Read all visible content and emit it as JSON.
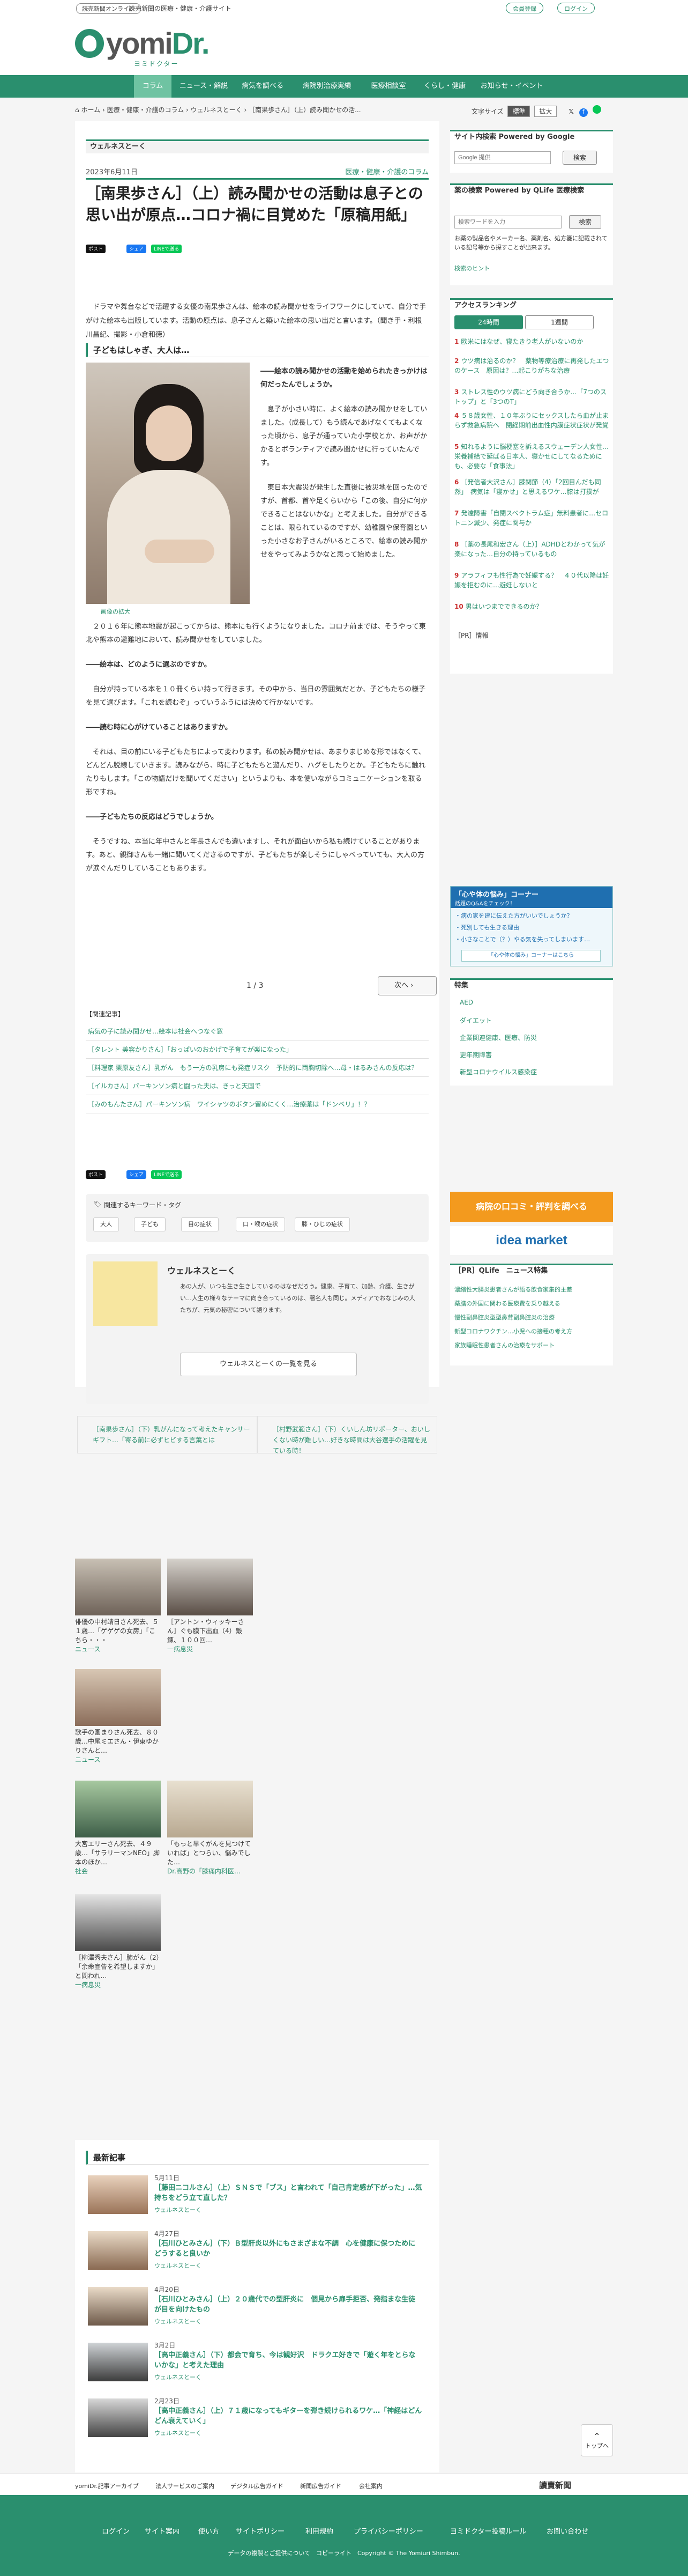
{
  "header": {
    "brand_link": "読売新聞オンライン",
    "tagline": "読売新聞の医療・健康・介護サイト",
    "register": "会員登録",
    "login": "ログイン",
    "logo_main": "yomi",
    "logo_accent": "Dr.",
    "logo_sub": "ヨミドクター"
  },
  "nav": [
    "コラム",
    "ニュース・解説",
    "病気を調べる",
    "病院別治療実績",
    "医療相談室",
    "くらし・健康",
    "お知らせ・イベント"
  ],
  "breadcrumb": [
    "ホーム",
    "医療・健康・介護のコラム",
    "ウェルネスとーく",
    "［南果歩さん］（上）読み聞かせの活..."
  ],
  "textsize": {
    "label": "文字サイズ",
    "standard": "標準",
    "large": "拡大"
  },
  "article": {
    "section": "ウェルネスとーく",
    "date": "2023年6月11日",
    "category": "医療・健康・介護のコラム",
    "title": "［南果歩さん］（上）読み聞かせの活動は息子との思い出が原点…コロナ禍に目覚めた「原稿用紙」",
    "share": {
      "post": "ポスト",
      "fb": "シェア",
      "line": "LINEで送る"
    },
    "lead": "ドラマや舞台などで活躍する女優の南果歩さんは、絵本の読み聞かせをライフワークにしていて、自分で手がけた絵本も出版しています。活動の原点は、息子さんと築いた絵本の思い出だと言います。（聞き手・利根川昌紀、撮影・小倉和徳）",
    "h2": "子どもはしゃぎ、大人は…",
    "zoom": "画像の拡大",
    "side_paras": [
      "――絵本の読み聞かせの活動を始められたきっかけは何だったんでしょうか。",
      "息子が小さい時に、よく絵本の読み聞かせをしていました。（成長して）もう読んであげなくてもよくなった頃から、息子が通っていた小学校とか、お声がかかるとボランティアで読み聞かせに行っていたんです。",
      "東日本大震災が発生した直後に被災地を回ったのですが、首都、首や足くらいから「この後、自分に何かできることはないかな」と考えました。自分ができることは、限られているのですが、幼稚園や保育園といった小さなお子さんがいるところで、絵本の読み聞かせをやってみようかなと思って始めました。"
    ],
    "body_paras": [
      "２０１６年に熊本地震が起こってからは、熊本にも行くようになりました。コロナ前までは、そうやって東北や熊本の避難地において、読み聞かせをしていました。",
      "――絵本は、どのように選ぶのですか。",
      "自分が持っている本を１０冊くらい持って行きます。その中から、当日の雰囲気だとか、子どもたちの様子を見て選びます。「これを読むぞ」っていうふうには決めて行かないです。",
      "――読む時に心がけていることはありますか。",
      "それは、目の前にいる子どもたちによって変わります。私の読み聞かせは、あまりまじめな形ではなくて、どんどん脱線していきます。読みながら、時に子どもたちと遊んだり、ハグをしたりとか。子どもたちに触れたりもします。「この物語だけを聞いてください」というよりも、本を使いながらコミュニケーションを取る形ですね。",
      "――子どもたちの反応はどうでしょうか。",
      "そうですね、本当に年中さんと年長さんでも違いますし、それが面白いから私も続けていることがあります。あと、親御さんも一緒に聞いてくださるのですが、子どもたちが楽しそうにしゃべっていても、大人の方が涙ぐんだりしていることもあります。"
    ],
    "pager": {
      "current": "1 / 3",
      "next": "次へ"
    }
  },
  "related": {
    "title": "【関連記事】",
    "items": [
      "病気の子に読み聞かせ…絵本は社会へつなぐ窓",
      "［タレント 美容かりさん］「おっぱいのおかげで子育てが楽になった」",
      "［料理家 栗原友さん］乳がん　もう一方の乳房にも発症リスク　予防的に両胸切除へ…母・はるみさんの反応は？",
      "［イルカさん］パーキンソン病と闘った夫は、きっと天国で",
      "［みのもんたさん］パーキンソン病　ワイシャツのボタン留めにくく…治療薬は「ドンペリ」！？"
    ]
  },
  "keywords": {
    "title": "関連するキーワード・タグ",
    "tags": [
      "大人",
      "子ども",
      "目の症状",
      "口・喉の症状",
      "膝・ひじの症状"
    ]
  },
  "author": {
    "name": "ウェルネスとーく",
    "desc": "あの人が、いつも生き生きしているのはなぜだろう。健康、子育て、加齢、介護、生きがい…人生の様々なテーマに向き合っているのは、著名人も同じ。メディアでおなじみの人たちが、元気の秘密について語ります。",
    "button": "ウェルネスとーくの一覧を見る"
  },
  "prevnext": {
    "prev": "［南果歩さん］（下）乳がんになって考えたキャンサーギフト…「寄る前に必ずヒビする言葉とは",
    "next": "［村野武範さん］（下）くいしん坊リポーター、おいしくない時が難しい…好きな時間は大谷選手の活躍を見ている時！"
  },
  "sidebar": {
    "search_title": "サイト内検索 Powered by Google",
    "search_placeholder": "Google 提供",
    "search_btn": "検索",
    "drug_title": "薬の検索 Powered by QLife 医療検索",
    "drug_placeholder": "検索ワードを入力",
    "drug_desc": "お薬の製品名やメーカー名、薬剤名、処方箋に記載されている記号等から探すことが出来ます。",
    "drug_hint": "検索のヒント",
    "ranking_title": "アクセスランキング",
    "tabs": [
      "24時間",
      "1週間"
    ],
    "ranking": [
      "欧米にはなぜ、寝たきり老人がいないのか",
      "ウツ病は治るのか？　薬物等療治療に再発したエつのケース　原因は？…起こりがちな治療",
      "ストレス性のウツ病にどう向き合うか…「7つのストップ」と「3つのT」",
      "５８歳女性、１０年ぶりにセックスしたら血が止まらず救急病院へ　閉経期前出血性内膜症状症状が発覚",
      "知れるように脳梗塞を訴えるスウェーデン人女性…栄養補給で延ばる日本人、寝かせにしてなるためにも、必要な「食事法」",
      "［発信者大沢さん］膝関節（4）「2回目んだも同然」　病気は「寝かせ」と思えるワケ…膝は打撲が",
      "発達障害「自閉スペクトラム症」無料患者に…セロトニン減少、発症に関与か",
      "［薬の長尾和宏さん（上）］ADHDとわかって気が楽になった…自分の持っているもの",
      "アラフィフも性行為で妊娠する？　４０代以降は妊娠を拒むのに…避妊しないと",
      "男はいつまでできるのか？"
    ],
    "pr": "［PR］情報",
    "nayami_title": "「心や体の悩み」コーナー",
    "nayami_sub": "話題のQ&Aをチェック！",
    "nayami_items": [
      "・病の家を建に伝えた方がいいでしょうか？",
      "・死別しても生きる理由",
      "・小さなことで（？）やる気を失ってしまいます…"
    ],
    "nayami_more": "「心や体の悩み」コーナーはこちら",
    "feature_title": "特集",
    "features": [
      "AED",
      "ダイエット",
      "企業関連健康、医療、防災",
      "更年期障害",
      "新型コロナウイルス感染症"
    ],
    "banner1": "病院の口コミ・評判を調べる",
    "banner2": "idea market",
    "qlife_title": "［PR］QLife　ニュース特集",
    "qlife": [
      "濃縮性大腸炎患者さんが語る飲食家集的主差",
      "薬膳の外国に関わる医療費を乗り越える",
      "慢性副鼻腔炎型型鼻茸副鼻腔炎の治療",
      "新型コロナワクチン…小児への接種の考え方",
      "家族睡眠性患者さんの治療をサポート"
    ]
  },
  "grid": [
    {
      "caption": "俳優の中村靖日さん死去、５１歳…「ゲゲゲの女房」「こちら・・・",
      "tag": "ニュース"
    },
    {
      "caption": "［アントン・ウィッキーさん］ぐも膜下出血（4）鍛錬、１００回…",
      "tag": "一病息災"
    },
    {
      "caption": "歌手の園まりさん死去、８０歳…中尾ミエさん・伊東ゆかりさんと…",
      "tag": "ニュース"
    },
    {
      "caption": "大宮エリーさん死去、４９歳…「サラリーマンNEO」脚本のほか…",
      "tag": "社会"
    },
    {
      "caption": "「もっと早くがんを見つけていれば」とつらい、悩みでした…",
      "tag": "Dr.高野の「膝痛内科医…"
    },
    {
      "caption": "［柳澤秀夫さん］肺がん（2）「余命宣告を希望しますか」と問われ…",
      "tag": "一病息災"
    }
  ],
  "latest": {
    "title": "最新記事",
    "items": [
      {
        "date": "5月11日",
        "title": "［藤田ニコルさん］（上）ＳＮＳで「ブス」と言われて「自己肯定感が下がった」…気持ちをどう立て直した？",
        "cat": "ウェルネスとーく"
      },
      {
        "date": "4月27日",
        "title": "［石川ひとみさん］（下）Ｂ型肝炎以外にもさまざまな不調　心を健康に保つためにどうすると良いか",
        "cat": "ウェルネスとーく"
      },
      {
        "date": "4月20日",
        "title": "［石川ひとみさん］（上）２０歳代での型肝炎に　個見から扉手拒否、発指まな生徒が目を向けたもの",
        "cat": "ウェルネスとーく"
      },
      {
        "date": "3月2日",
        "title": "［高中正義さん］（下）都会で育ち、今は観好沢　ドラクエ好きで「遊く年をとらないかな」と考えた理由",
        "cat": "ウェルネスとーく"
      },
      {
        "date": "2月23日",
        "title": "［高中正義さん］（上）７１歳になってもギターを弾き続けられるワケ…「神経はどんどん衰えていく」",
        "cat": "ウェルネスとーく"
      }
    ]
  },
  "footer_small": [
    "yomiDr.記事アーカイブ",
    "法人サービスのご案内",
    "デジタル広告ガイド",
    "新聞広告ガイド",
    "会社案内"
  ],
  "footer": [
    "ログイン",
    "サイト案内",
    "使い方",
    "サイトポリシー",
    "利用規約",
    "プライバシーポリシー",
    "ヨミドクター投稿ルール",
    "お問い合わせ"
  ],
  "copyright": "データの複製とご提供について　コピーライト　Copyright © The Yomiuri Shimbun.",
  "top_button": "トップへ",
  "colors": {
    "brand": "#2a8f6e",
    "accent": "#c33"
  }
}
